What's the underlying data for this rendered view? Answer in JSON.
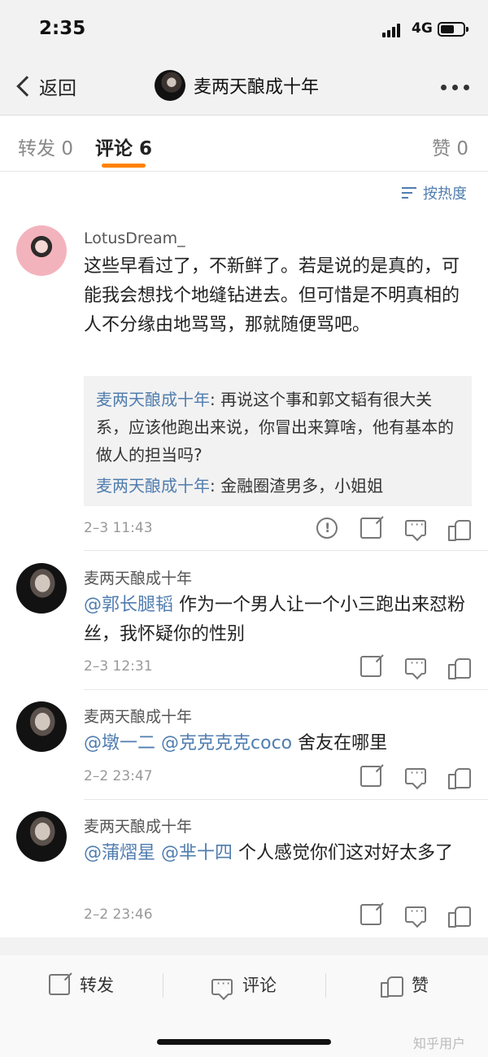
{
  "status": {
    "time": "2:35",
    "network": "4G"
  },
  "nav": {
    "back_label": "返回",
    "title": "麦两天酿成十年"
  },
  "tabs": [
    {
      "label": "转发",
      "count": "0"
    },
    {
      "label": "评论",
      "count": "6"
    },
    {
      "label": "赞",
      "count": "0"
    }
  ],
  "sort_label": "按热度",
  "comments": [
    {
      "author": "LotusDream_",
      "text": "这些早看过了，不新鲜了。若是说的是真的，可能我会想找个地缝钻进去。但可惜是不明真相的人不分缘由地骂骂，那就随便骂吧。",
      "replies": [
        {
          "name": "麦两天酿成十年",
          "text": ": 再说这个事和郭文韬有很大关系，应该他跑出来说，你冒出来算啥，他有基本的做人的担当吗?"
        },
        {
          "name": "麦两天酿成十年",
          "text": ": 金融圈渣男多，小姐姐"
        }
      ],
      "time": "2–3 11:43"
    },
    {
      "author": "麦两天酿成十年",
      "mentions": [
        "@郭长腿韬"
      ],
      "text": " 作为一个男人让一个小三跑出来怼粉丝，我怀疑你的性别",
      "time": "2–3 12:31"
    },
    {
      "author": "麦两天酿成十年",
      "mentions": [
        "@墩一二",
        "@克克克克coco"
      ],
      "text": " 舍友在哪里",
      "time": "2–2 23:47"
    },
    {
      "author": "麦两天酿成十年",
      "mentions": [
        "@蒲熠星",
        "@芈十四"
      ],
      "text": " 个人感觉你们这对好太多了",
      "time": "2–2 23:46"
    }
  ],
  "bottom_bar": {
    "repost": "转发",
    "comment": "评论",
    "like": "赞"
  },
  "watermark": "知乎用户",
  "colors": {
    "accent": "#ff8200",
    "link": "#507daf"
  }
}
